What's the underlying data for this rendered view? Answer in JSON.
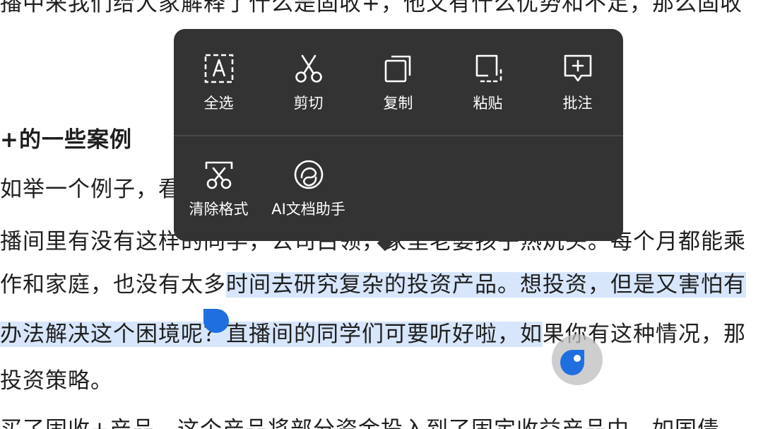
{
  "document": {
    "line_top": "播中来我们给大家解释了什么是固收+，他又有什么优势和不足，那么固收",
    "heading": "+的一些案例",
    "line_example": "如举一个例子，看",
    "line_broadcast": "播间里有没有这样的同学，公司白领，家里老婆孩子热炕头。每个月都能乘",
    "line_work_plain": "作和家庭，也没有太多",
    "line_work_selected": "时间去研究复杂的投资产品。想投资，但是又害怕有",
    "line_solve_selected": "办法解决这个困境呢？直播间的同学们可要听好啦，如",
    "line_solve_plain": "果你有这种情况，那",
    "line_strategy": "投资策略。",
    "line_bottom": "买了固收+产品，这个产品将部分资金投入到了固定收益产品中，如国债、"
  },
  "context_menu": {
    "items": [
      {
        "label": "全选",
        "icon": "select-all-icon"
      },
      {
        "label": "剪切",
        "icon": "scissors-icon"
      },
      {
        "label": "复制",
        "icon": "copy-icon"
      },
      {
        "label": "粘贴",
        "icon": "paste-icon"
      },
      {
        "label": "批注",
        "icon": "comment-add-icon"
      },
      {
        "label": "清除格式",
        "icon": "clear-format-icon"
      },
      {
        "label": "AI文档助手",
        "icon": "ai-assistant-icon"
      }
    ]
  },
  "colors": {
    "selection": "#d7e6fb",
    "handle": "#1f6fe0",
    "menu_bg": "#333333"
  }
}
